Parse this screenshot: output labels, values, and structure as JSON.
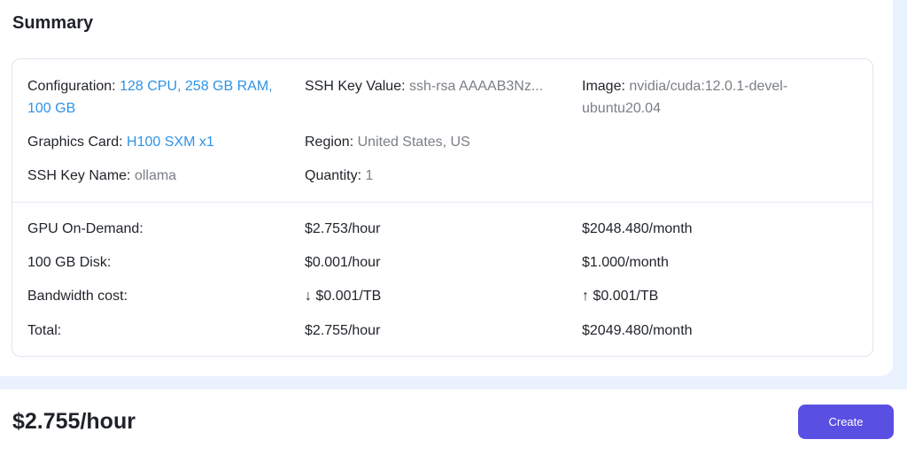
{
  "summary": {
    "title": "Summary",
    "details": {
      "configuration": {
        "label": "Configuration:",
        "value": "128 CPU, 258 GB RAM, 100 GB"
      },
      "ssh_key_value": {
        "label": "SSH Key Value:",
        "value": "ssh-rsa AAAAB3Nz..."
      },
      "image": {
        "label": "Image:",
        "value": "nvidia/cuda:12.0.1-devel-ubuntu20.04"
      },
      "graphics_card": {
        "label": "Graphics Card:",
        "value": "H100 SXM x1"
      },
      "region": {
        "label": "Region:",
        "value": "United States, US"
      },
      "ssh_key_name": {
        "label": "SSH Key Name:",
        "value": "ollama"
      },
      "quantity": {
        "label": "Quantity:",
        "value": "1"
      }
    },
    "costs": [
      {
        "label": "GPU On-Demand:",
        "hourly": "$2.753/hour",
        "monthly": "$2048.480/month"
      },
      {
        "label": "100 GB Disk:",
        "hourly": "$0.001/hour",
        "monthly": "$1.000/month"
      },
      {
        "label": "Bandwidth cost:",
        "hourly": "↓ $0.001/TB",
        "monthly": "↑ $0.001/TB"
      },
      {
        "label": "Total:",
        "hourly": "$2.755/hour",
        "monthly": "$2049.480/month"
      }
    ]
  },
  "footer": {
    "price": "$2.755/hour",
    "create_label": "Create"
  },
  "colors": {
    "accent_blue": "#2f93e6",
    "button_purple": "#5a4fe3",
    "page_background": "#eaf3fd"
  }
}
